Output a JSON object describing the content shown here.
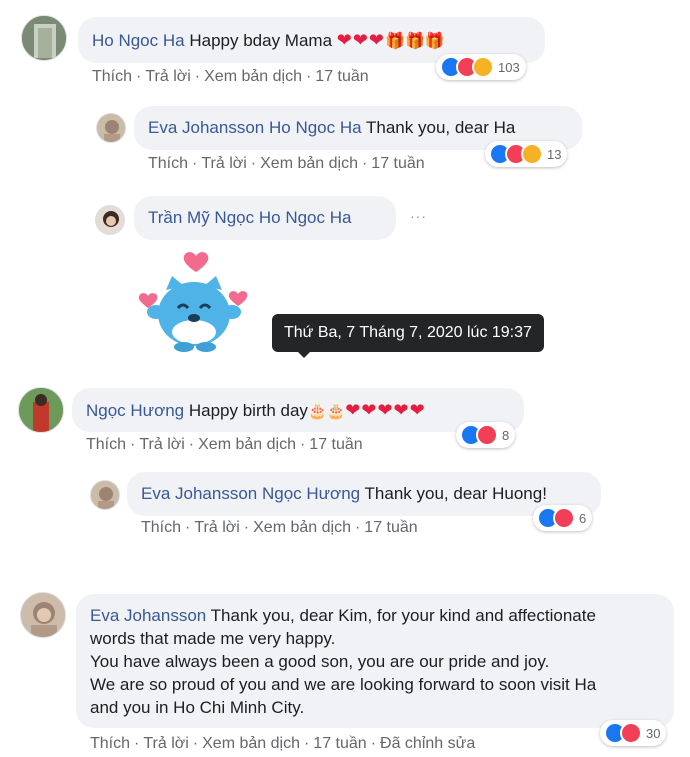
{
  "actions": {
    "like": "Thích",
    "reply": "Trả lời",
    "translate": "Xem bản dịch",
    "sep": "·",
    "edited": "Đã chỉnh sửa"
  },
  "comments": [
    {
      "author": "Ho Ngoc Ha",
      "text": "Happy bday Mama",
      "emojis_hearts": "❤❤❤",
      "emojis_gifts": "🎁🎁🎁",
      "time": "17 tuần",
      "reaction_count": "103",
      "reaction_icons": [
        "like",
        "love",
        "care"
      ]
    },
    {
      "author": "Eva Johansson",
      "mention": "Ho Ngoc Ha",
      "text": "Thank you, dear Ha",
      "time": "17 tuần",
      "reaction_count": "13",
      "reaction_icons": [
        "like",
        "love",
        "care"
      ]
    },
    {
      "author": "Trần Mỹ Ngọc",
      "mention": "Ho Ngoc Ha",
      "more": "···",
      "sticker": "cat-hearts-sticker"
    },
    {
      "author": "Ngọc Hương",
      "text": "Happy birth day",
      "emojis_cakes": "🎂🎂",
      "emojis_hearts": "❤❤❤❤❤",
      "time": "17 tuần",
      "reaction_count": "8",
      "reaction_icons": [
        "like",
        "love"
      ]
    },
    {
      "author": "Eva Johansson",
      "mention": "Ngọc Hương",
      "text": "Thank you, dear Huong!",
      "time": "17 tuần",
      "reaction_count": "6",
      "reaction_icons": [
        "like",
        "love"
      ]
    },
    {
      "author": "Eva Johansson",
      "lines": [
        "Thank you, dear Kim, for your kind and affectionate",
        "words that made me very happy.",
        "You have always been a good son, you are our pride and joy.",
        "We are so proud of you and we are looking forward to soon visit Ha",
        "and you in Ho Chi Minh City."
      ],
      "time": "17 tuần",
      "reaction_count": "30",
      "reaction_icons": [
        "like",
        "love"
      ]
    }
  ],
  "tooltip": "Thứ Ba, 7 Tháng 7, 2020 lúc 19:37",
  "colors": {
    "author": "#385898",
    "bubble": "#f0f2f5",
    "like": "#1877f2",
    "love": "#f33e58",
    "care": "#f7b125",
    "sticker": "#4fb3e8"
  }
}
